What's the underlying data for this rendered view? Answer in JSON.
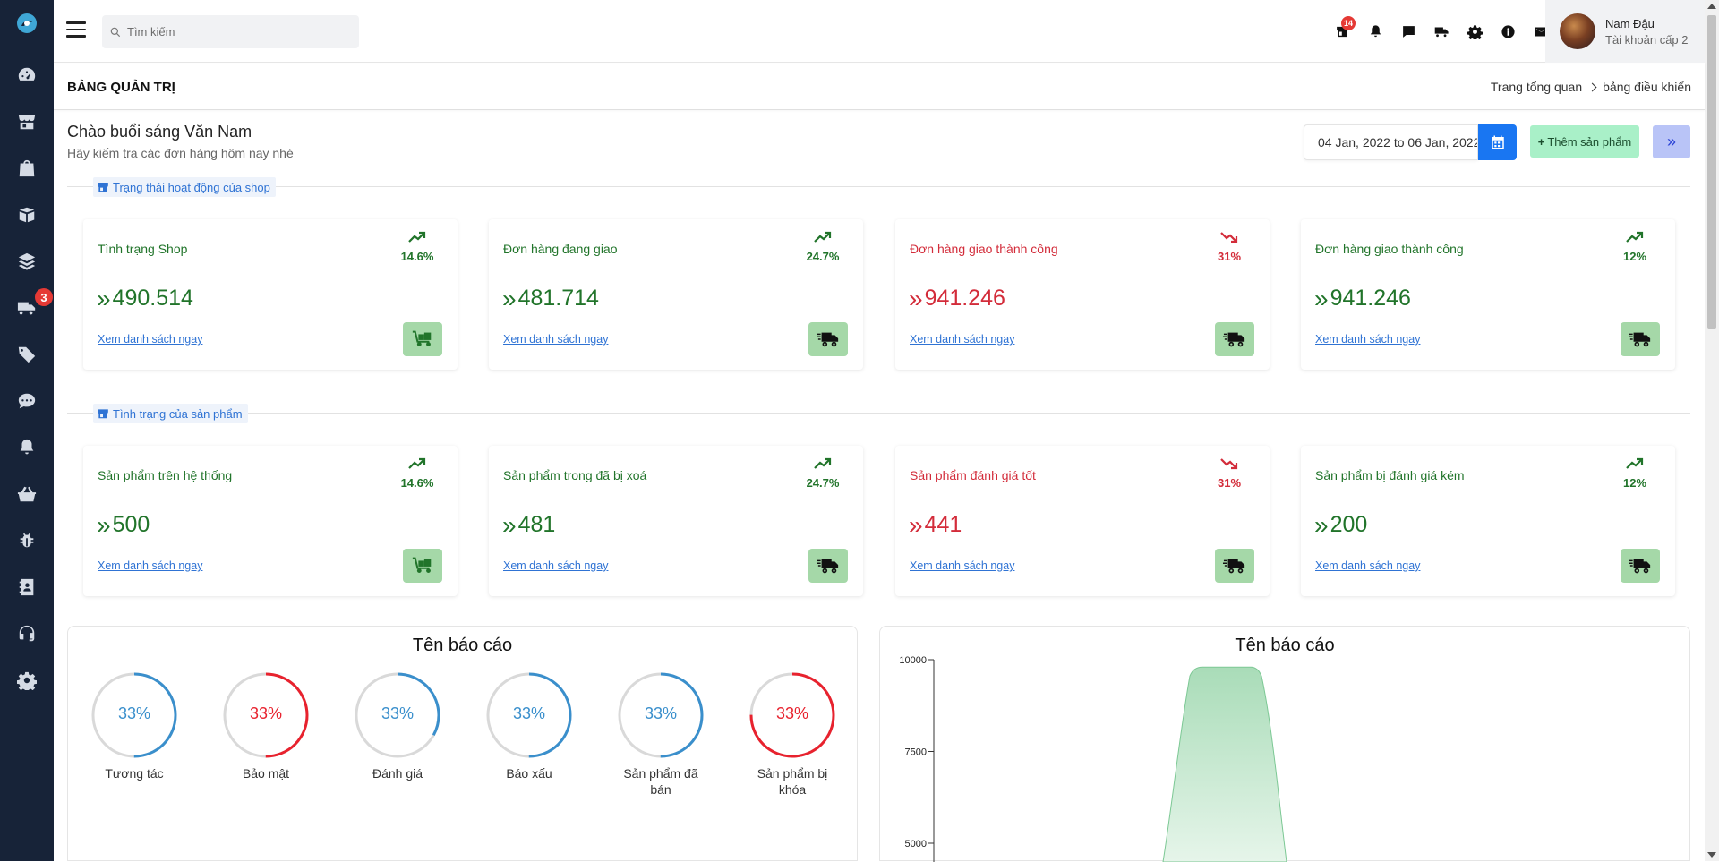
{
  "sidebar": {
    "badge": "3",
    "items": [
      {
        "icon": "dashboard-icon"
      },
      {
        "icon": "store-icon"
      },
      {
        "icon": "bag-icon"
      },
      {
        "icon": "box-icon"
      },
      {
        "icon": "layers-icon"
      },
      {
        "icon": "truck-icon"
      },
      {
        "icon": "tag-icon"
      },
      {
        "icon": "chat-icon"
      },
      {
        "icon": "bell-icon"
      },
      {
        "icon": "basket-icon"
      },
      {
        "icon": "bug-icon"
      },
      {
        "icon": "contact-book-icon"
      },
      {
        "icon": "headset-icon"
      },
      {
        "icon": "gear-icon"
      }
    ]
  },
  "topbar": {
    "search_placeholder": "Tìm kiếm",
    "store_badge": "14",
    "user": {
      "name": "Nam Đậu",
      "role": "Tài khoản cấp 2"
    }
  },
  "page": {
    "title": "BẢNG QUẢN TRỊ",
    "breadcrumb": [
      "Trang tổng quan",
      "bảng điều khiển"
    ],
    "greeting": "Chào buổi sáng Văn Nam",
    "greeting_sub": "Hãy kiếm tra các đơn hàng hôm nay nhé",
    "date_range": "04 Jan, 2022 to 06 Jan, 2022",
    "add_product": "Thêm sản phẩm"
  },
  "sections": [
    {
      "label": "Trạng thái hoạt động của shop",
      "cards": [
        {
          "title": "Tình trạng Shop",
          "value": "490.514",
          "pct": "14.6%",
          "trend": "up",
          "link": "Xem danh sách ngay",
          "icon": "dolly-icon",
          "color": "green"
        },
        {
          "title": "Đơn hàng đang giao",
          "value": "481.714",
          "pct": "24.7%",
          "trend": "up",
          "link": "Xem danh sách ngay",
          "icon": "delivery-truck-icon",
          "color": "green"
        },
        {
          "title": "Đơn hàng giao thành công",
          "value": "941.246",
          "pct": "31%",
          "trend": "down",
          "link": "Xem danh sách ngay",
          "icon": "delivery-truck-icon",
          "color": "red"
        },
        {
          "title": "Đơn hàng giao thành công",
          "value": "941.246",
          "pct": "12%",
          "trend": "up",
          "link": "Xem danh sách ngay",
          "icon": "delivery-truck-icon",
          "color": "green"
        }
      ]
    },
    {
      "label": "Tình trạng của sản phẩm",
      "cards": [
        {
          "title": "Sản phẩm trên hệ thống",
          "value": "500",
          "pct": "14.6%",
          "trend": "up",
          "link": "Xem danh sách ngay",
          "icon": "dolly-icon",
          "color": "green"
        },
        {
          "title": "Sản phẩm trong đã bị xoá",
          "value": "481",
          "pct": "24.7%",
          "trend": "up",
          "link": "Xem danh sách ngay",
          "icon": "delivery-truck-icon",
          "color": "green"
        },
        {
          "title": "Sản phẩm đánh giá tốt",
          "value": "441",
          "pct": "31%",
          "trend": "down",
          "link": "Xem danh sách ngay",
          "icon": "delivery-truck-icon",
          "color": "red"
        },
        {
          "title": "Sản phẩm bị đánh giá kém",
          "value": "200",
          "pct": "12%",
          "trend": "up",
          "link": "Xem danh sách ngay",
          "icon": "delivery-truck-icon",
          "color": "green"
        }
      ]
    }
  ],
  "colors": {
    "green": "#21742a",
    "red": "#d32c3a",
    "gauge_blue": "#3a8fcc",
    "gauge_red": "#e8222e",
    "gauge_track": "#d9d9d9",
    "area_fill": "#a9dcb8"
  },
  "report_gauges": {
    "title": "Tên báo cáo",
    "items": [
      {
        "label": "Tương tác",
        "pct": "33%",
        "value": 0.5,
        "color": "blue"
      },
      {
        "label": "Bảo mật",
        "pct": "33%",
        "value": 0.5,
        "color": "red"
      },
      {
        "label": "Đánh giá",
        "pct": "33%",
        "value": 0.33,
        "color": "blue"
      },
      {
        "label": "Báo xấu",
        "pct": "33%",
        "value": 0.5,
        "color": "blue"
      },
      {
        "label": "Sản phẩm đã bán",
        "pct": "33%",
        "value": 0.5,
        "color": "blue"
      },
      {
        "label": "Sản phẩm bị khóa",
        "pct": "33%",
        "value": 0.75,
        "color": "red"
      }
    ]
  },
  "report_chart": {
    "title": "Tên báo cáo"
  },
  "chart_data": {
    "type": "area",
    "title": "Tên báo cáo",
    "xlabel": "",
    "ylabel": "",
    "y_ticks": [
      10000,
      7500,
      5000
    ],
    "ylim": [
      4000,
      10000
    ],
    "series": [
      {
        "values_visible": {
          "peak": 9800
        }
      }
    ]
  }
}
